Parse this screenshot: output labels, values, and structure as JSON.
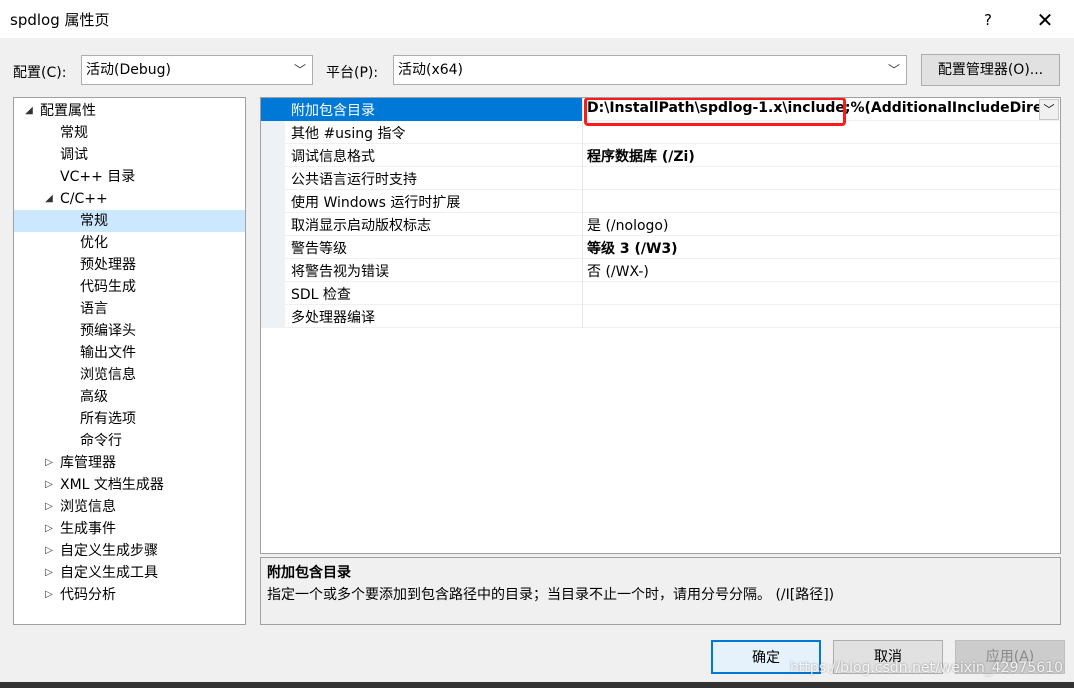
{
  "window": {
    "title": "spdlog 属性页",
    "help": "?",
    "close": "✕"
  },
  "toolbar": {
    "config_label": "配置(C):",
    "config_value": "活动(Debug)",
    "platform_label": "平台(P):",
    "platform_value": "活动(x64)",
    "config_manager": "配置管理器(O)..."
  },
  "tree": [
    {
      "label": "配置属性",
      "level": 0,
      "expander": "◢"
    },
    {
      "label": "常规",
      "level": 1,
      "expander": ""
    },
    {
      "label": "调试",
      "level": 1,
      "expander": ""
    },
    {
      "label": "VC++ 目录",
      "level": 1,
      "expander": ""
    },
    {
      "label": "C/C++",
      "level": 1,
      "expander": "◢"
    },
    {
      "label": "常规",
      "level": 2,
      "expander": "",
      "selected": true
    },
    {
      "label": "优化",
      "level": 2,
      "expander": ""
    },
    {
      "label": "预处理器",
      "level": 2,
      "expander": ""
    },
    {
      "label": "代码生成",
      "level": 2,
      "expander": ""
    },
    {
      "label": "语言",
      "level": 2,
      "expander": ""
    },
    {
      "label": "预编译头",
      "level": 2,
      "expander": ""
    },
    {
      "label": "输出文件",
      "level": 2,
      "expander": ""
    },
    {
      "label": "浏览信息",
      "level": 2,
      "expander": ""
    },
    {
      "label": "高级",
      "level": 2,
      "expander": ""
    },
    {
      "label": "所有选项",
      "level": 2,
      "expander": ""
    },
    {
      "label": "命令行",
      "level": 2,
      "expander": ""
    },
    {
      "label": "库管理器",
      "level": 1,
      "expander": "▷"
    },
    {
      "label": "XML 文档生成器",
      "level": 1,
      "expander": "▷"
    },
    {
      "label": "浏览信息",
      "level": 1,
      "expander": "▷"
    },
    {
      "label": "生成事件",
      "level": 1,
      "expander": "▷"
    },
    {
      "label": "自定义生成步骤",
      "level": 1,
      "expander": "▷"
    },
    {
      "label": "自定义生成工具",
      "level": 1,
      "expander": "▷"
    },
    {
      "label": "代码分析",
      "level": 1,
      "expander": "▷"
    }
  ],
  "properties": [
    {
      "name": "附加包含目录",
      "value": "D:\\InstallPath\\spdlog-1.x\\include;%(AdditionalIncludeDirect",
      "bold": true,
      "selected": true
    },
    {
      "name": "其他 #using 指令",
      "value": "",
      "bold": false
    },
    {
      "name": "调试信息格式",
      "value": "程序数据库 (/Zi)",
      "bold": true
    },
    {
      "name": "公共语言运行时支持",
      "value": "",
      "bold": false
    },
    {
      "name": "使用 Windows 运行时扩展",
      "value": "",
      "bold": false
    },
    {
      "name": "取消显示启动版权标志",
      "value": "是 (/nologo)",
      "bold": false
    },
    {
      "name": "警告等级",
      "value": "等级 3 (/W3)",
      "bold": true
    },
    {
      "name": "将警告视为错误",
      "value": "否 (/WX-)",
      "bold": false
    },
    {
      "name": "SDL 检查",
      "value": "",
      "bold": false
    },
    {
      "name": "多处理器编译",
      "value": "",
      "bold": false
    }
  ],
  "description": {
    "title": "附加包含目录",
    "text": "指定一个或多个要添加到包含路径中的目录；当目录不止一个时，请用分号分隔。     (/I[路径])"
  },
  "buttons": {
    "ok": "确定",
    "cancel": "取消",
    "apply": "应用(A)"
  },
  "watermark": "https://blog.csdn.net/weixin_42975610",
  "colors": {
    "selection": "#0078d7",
    "tree_selection": "#cce8ff",
    "highlight": "#ff1a1a"
  }
}
